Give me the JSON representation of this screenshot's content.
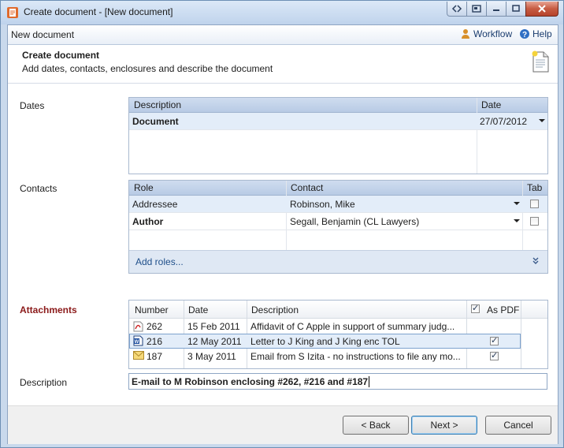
{
  "window": {
    "title": "Create document - [New document]"
  },
  "toolbar": {
    "title": "New document",
    "workflow_label": "Workflow",
    "help_label": "Help"
  },
  "header": {
    "title": "Create document",
    "subtitle": "Add dates, contacts, enclosures and describe the document"
  },
  "dates": {
    "label": "Dates",
    "columns": [
      "Description",
      "Date"
    ],
    "rows": [
      {
        "description": "Document",
        "date": "27/07/2012"
      }
    ]
  },
  "contacts": {
    "label": "Contacts",
    "columns": [
      "Role",
      "Contact",
      "Tab"
    ],
    "rows": [
      {
        "role": "Addressee",
        "contact": "Robinson, Mike",
        "tab": false
      },
      {
        "role": "Author",
        "contact": "Segall, Benjamin (CL Lawyers)",
        "tab": false
      }
    ],
    "add_roles_label": "Add roles..."
  },
  "attachments": {
    "label": "Attachments",
    "columns": [
      "Number",
      "Date",
      "Description",
      "As PDF"
    ],
    "as_pdf_all": true,
    "rows": [
      {
        "icon": "pdf-icon",
        "number": "262",
        "date": "15 Feb 2011",
        "description": "Affidavit of C Apple in support of summary judg...",
        "as_pdf": null
      },
      {
        "icon": "word-icon",
        "number": "216",
        "date": "12 May 2011",
        "description": "Letter to J King and J King enc TOL",
        "as_pdf": true
      },
      {
        "icon": "email-icon",
        "number": "187",
        "date": "3 May 2011",
        "description": "Email from S Izita - no instructions to file any mo...",
        "as_pdf": true
      }
    ]
  },
  "description": {
    "label": "Description",
    "value": "E-mail to M Robinson enclosing #262, #216 and #187"
  },
  "buttons": {
    "back": "< Back",
    "next": "Next >",
    "cancel": "Cancel"
  },
  "colors": {
    "accent_red": "#8b1a1a",
    "header_blue": "#c4d4eb",
    "selection": "#dfeaf8"
  }
}
